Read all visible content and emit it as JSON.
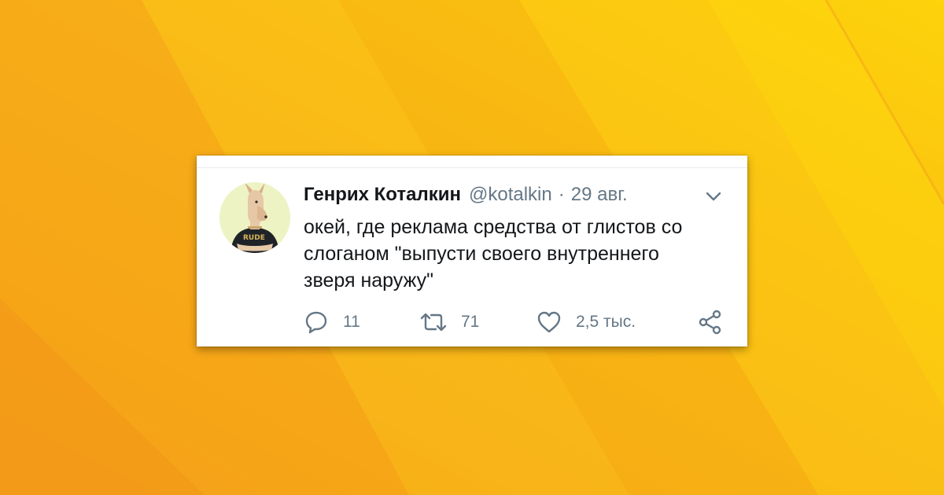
{
  "background": {
    "colors": [
      "#f7a21b",
      "#fbc21a",
      "#f6b00e",
      "#fdd20c"
    ]
  },
  "tweet": {
    "author_name": "Генрих Коталкин",
    "handle": "@kotalkin",
    "separator": "·",
    "date": "29 авг.",
    "text": "окей, где реклама средства от глистов со\nслоганом \"выпусти своего внутреннего\nзверя наружу\"",
    "avatar_shirt_text": "RUDE",
    "stats": {
      "replies": "11",
      "retweets": "71",
      "likes": "2,5 тыс."
    },
    "icons": {
      "menu": "chevron-down-icon",
      "reply": "reply-icon",
      "retweet": "retweet-icon",
      "like": "heart-icon",
      "share": "share-icon"
    },
    "colors": {
      "text": "#14171a",
      "secondary": "#657786",
      "card": "#ffffff"
    }
  }
}
